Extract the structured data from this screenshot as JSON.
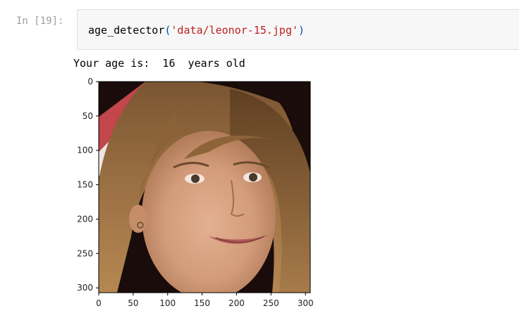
{
  "cell": {
    "prompt": "In [19]:",
    "code": {
      "function": "age_detector",
      "open_paren": "(",
      "argument": "'data/leonor-15.jpg'",
      "close_paren": ")"
    }
  },
  "output": {
    "text": "Your age is:  16  years old"
  },
  "chart_data": {
    "type": "image",
    "x_ticks": [
      "0",
      "50",
      "100",
      "150",
      "200",
      "250",
      "300"
    ],
    "y_ticks": [
      "0",
      "50",
      "100",
      "150",
      "200",
      "250",
      "300"
    ],
    "x_tick_values": [
      0,
      50,
      100,
      150,
      200,
      250,
      300
    ],
    "y_tick_values": [
      0,
      50,
      100,
      150,
      200,
      250,
      300
    ],
    "xlim": [
      0,
      307
    ],
    "ylim": [
      307,
      0
    ]
  },
  "colors": {
    "prompt": "#9e9e9e",
    "code_string": "#ba2121",
    "code_paren": "#0055aa",
    "cell_background": "#f7f7f7"
  }
}
